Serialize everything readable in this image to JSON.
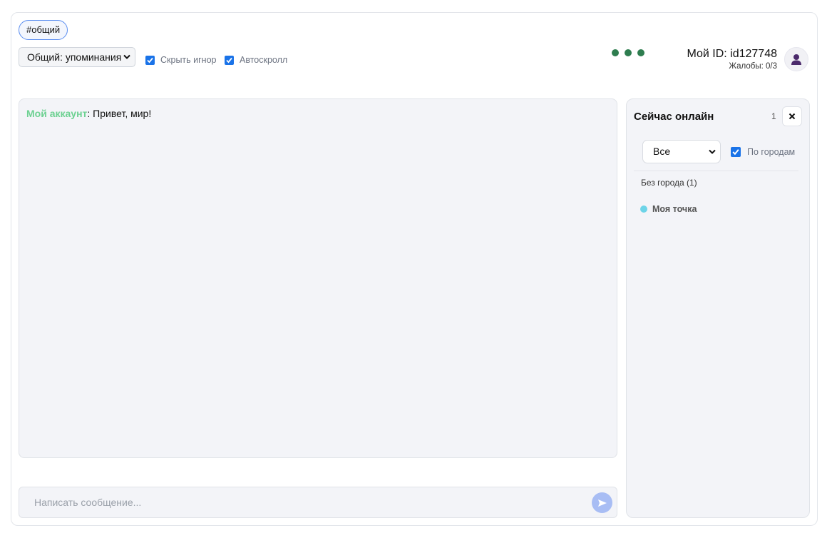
{
  "channel_tab": {
    "label": "#общий"
  },
  "toolbar": {
    "filter_select_value": "Общий: упоминания",
    "hide_ignore_label": "Скрыть игнор",
    "hide_ignore_checked": true,
    "autoscroll_label": "Автоскролл",
    "autoscroll_checked": true
  },
  "account": {
    "id_text": "Мой ID: id127748",
    "complaints_text": "Жалобы: 0/3",
    "avatar_icon": "user-icon"
  },
  "status_indicator": {
    "dot_count": 3,
    "color": "#2e7d4f"
  },
  "chat": {
    "messages": [
      {
        "author": "Мой аккаунт",
        "separator": ":",
        "text": " Привет, мир!",
        "author_color": "#6dd192"
      }
    ]
  },
  "composer": {
    "placeholder": "Написать сообщение...",
    "send_icon": "send-icon"
  },
  "online_panel": {
    "title": "Сейчас онлайн",
    "count": "1",
    "close_icon": "close-icon",
    "city_select_value": "Все",
    "by_city_label": "По городам",
    "by_city_checked": true,
    "groups": [
      {
        "label": "Без города (1)",
        "users": [
          {
            "name": "Моя точка",
            "presence_color": "#6dd4e8"
          }
        ]
      }
    ]
  },
  "colors": {
    "accent": "#1a73e8",
    "tab_border": "#5b8ef0",
    "send_button": "#a8bdf4"
  }
}
